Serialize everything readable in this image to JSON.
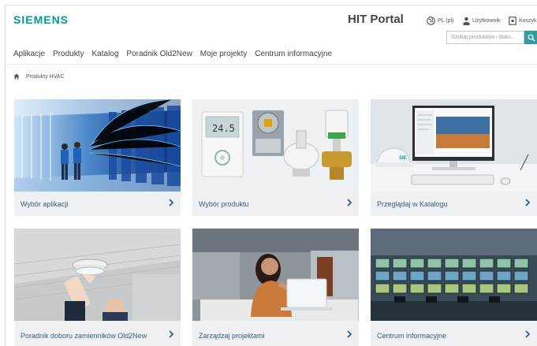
{
  "header": {
    "logo": "SIEMENS",
    "title": "HIT Portal",
    "language": "PL (pl)",
    "user": "Użytkownik",
    "cart": "Koszyk",
    "search_placeholder": "Szukaj produktów i doku..."
  },
  "nav": {
    "items": [
      "Aplikacje",
      "Produkty",
      "Katalog",
      "Poradnik Old2New",
      "Moje projekty",
      "Centrum informacyjne"
    ]
  },
  "breadcrumb": {
    "current": "Produkty HVAC"
  },
  "cards": [
    {
      "label": "Wybór aplikacji"
    },
    {
      "label": "Wybór produktu"
    },
    {
      "label": "Przeglądaj w Katalogu"
    },
    {
      "label": "Poradnik doboru zamienników Old2New"
    },
    {
      "label": "Zarządzaj projektami"
    },
    {
      "label": "Centrum informacyjne"
    }
  ],
  "product_image": {
    "thermostat_reading": "24.5"
  },
  "colors": {
    "brand": "#009999",
    "link": "#3a5d86",
    "search_button": "#2e9ca3"
  }
}
